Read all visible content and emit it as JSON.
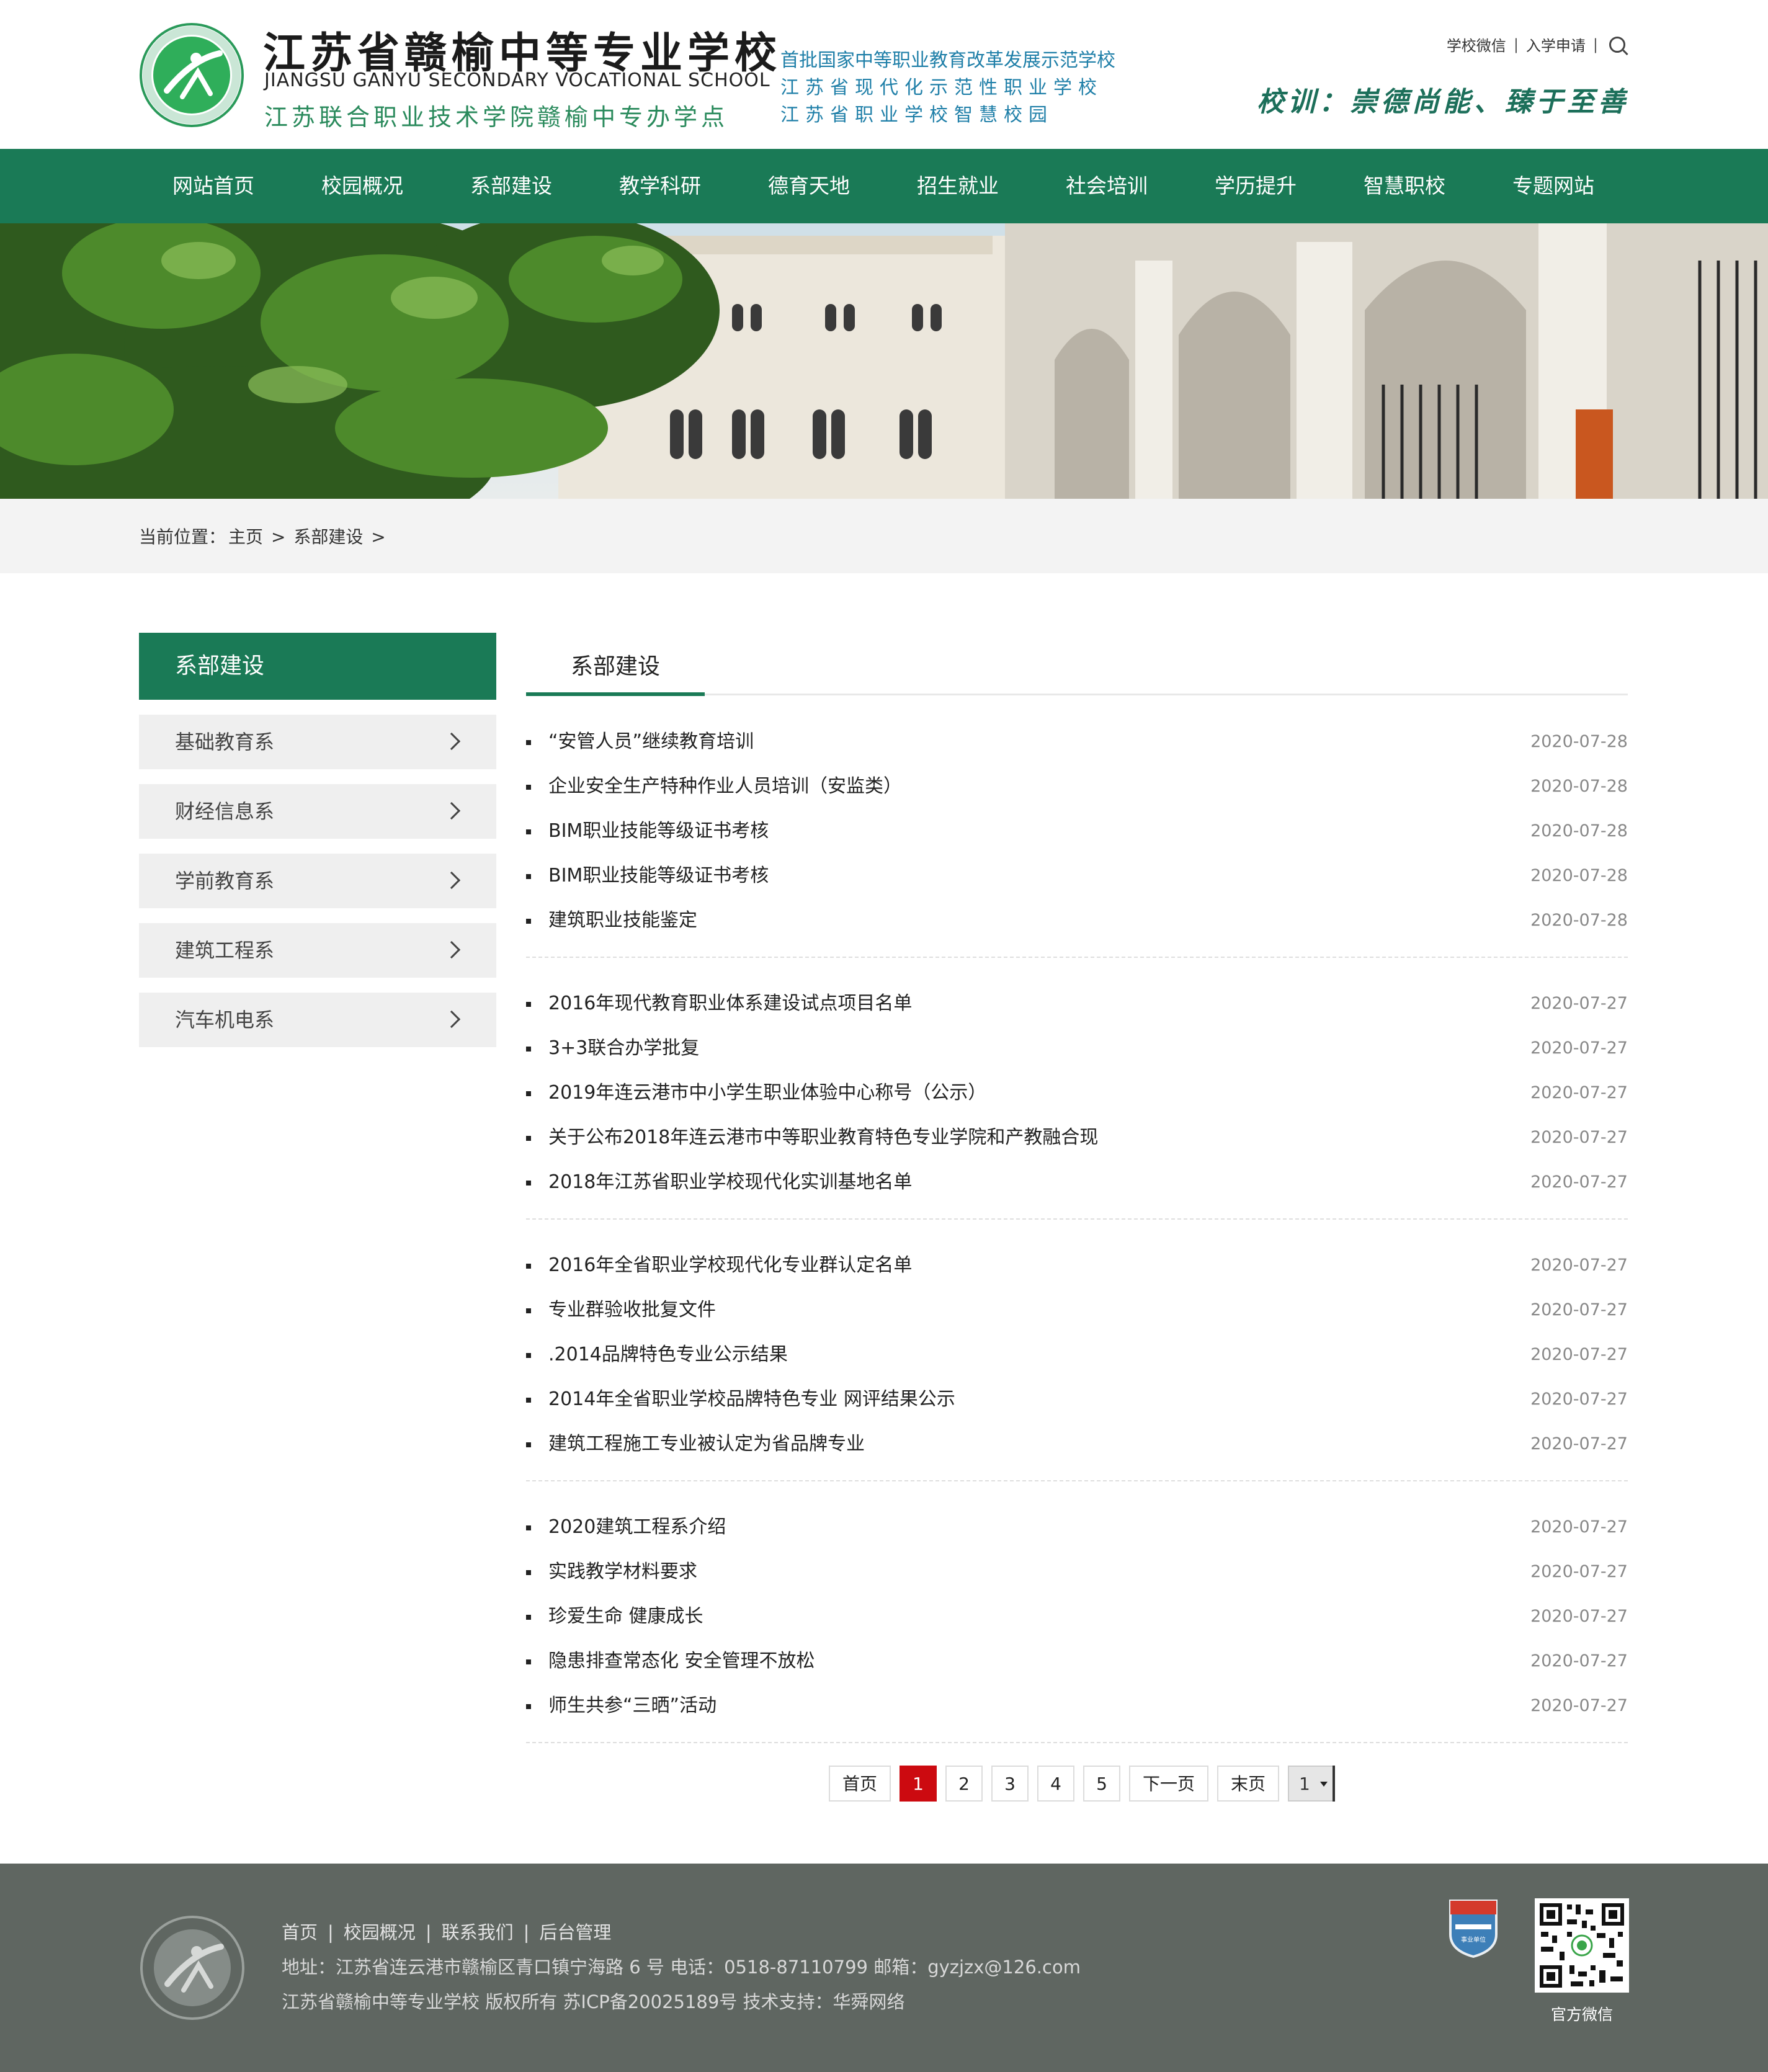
{
  "header": {
    "logo_cn": "江苏省赣榆中等专业学校",
    "logo_en": "JIANGSU GANYU SECONDARY VOCATIONAL SCHOOL",
    "logo_sub": "江苏联合职业技术学院赣榆中专办学点",
    "slogans": [
      "首批国家中等职业教育改革发展示范学校",
      "江苏省现代化示范性职业学校",
      "江苏省职业学校智慧校园"
    ],
    "toplinks": [
      "学校微信",
      "入学申请"
    ],
    "motto": "校训：崇德尚能、臻于至善"
  },
  "nav": [
    "网站首页",
    "校园概况",
    "系部建设",
    "教学科研",
    "德育天地",
    "招生就业",
    "社会培训",
    "学历提升",
    "智慧职校",
    "专题网站"
  ],
  "breadcrumb": {
    "prefix": "当前位置：",
    "home": "主页",
    "sep": ">",
    "current": "系部建设",
    "tail": ">"
  },
  "sidebar": {
    "title": "系部建设",
    "items": [
      "基础教育系",
      "财经信息系",
      "学前教育系",
      "建筑工程系",
      "汽车机电系"
    ]
  },
  "content": {
    "tab": "系部建设",
    "groups": [
      [
        {
          "title": "“安管人员”继续教育培训",
          "date": "2020-07-28"
        },
        {
          "title": "企业安全生产特种作业人员培训（安监类）",
          "date": "2020-07-28"
        },
        {
          "title": "BIM职业技能等级证书考核",
          "date": "2020-07-28"
        },
        {
          "title": "BIM职业技能等级证书考核",
          "date": "2020-07-28"
        },
        {
          "title": "建筑职业技能鉴定",
          "date": "2020-07-28"
        }
      ],
      [
        {
          "title": "2016年现代教育职业体系建设试点项目名单",
          "date": "2020-07-27"
        },
        {
          "title": "3+3联合办学批复",
          "date": "2020-07-27"
        },
        {
          "title": "2019年连云港市中小学生职业体验中心称号（公示）",
          "date": "2020-07-27"
        },
        {
          "title": "关于公布2018年连云港市中等职业教育特色专业学院和产教融合现",
          "date": "2020-07-27"
        },
        {
          "title": "2018年江苏省职业学校现代化实训基地名单",
          "date": "2020-07-27"
        }
      ],
      [
        {
          "title": "2016年全省职业学校现代化专业群认定名单",
          "date": "2020-07-27"
        },
        {
          "title": "专业群验收批复文件",
          "date": "2020-07-27"
        },
        {
          "title": ".2014品牌特色专业公示结果",
          "date": "2020-07-27"
        },
        {
          "title": "2014年全省职业学校品牌特色专业 网评结果公示",
          "date": "2020-07-27"
        },
        {
          "title": "建筑工程施工专业被认定为省品牌专业",
          "date": "2020-07-27"
        }
      ],
      [
        {
          "title": "2020建筑工程系介绍",
          "date": "2020-07-27"
        },
        {
          "title": "实践教学材料要求",
          "date": "2020-07-27"
        },
        {
          "title": "珍爱生命 健康成长",
          "date": "2020-07-27"
        },
        {
          "title": "隐患排查常态化 安全管理不放松",
          "date": "2020-07-27"
        },
        {
          "title": "师生共参“三晒”活动",
          "date": "2020-07-27"
        }
      ]
    ]
  },
  "pager": {
    "first": "首页",
    "pages": [
      "1",
      "2",
      "3",
      "4",
      "5"
    ],
    "current": "1",
    "next": "下一页",
    "last": "末页",
    "select_value": "1"
  },
  "footer": {
    "links": [
      "首页",
      "校园概况",
      "联系我们",
      "后台管理"
    ],
    "address": "地址：江苏省连云港市赣榆区青口镇宁海路 6 号  电话：0518-87110799  邮箱：gyzjzx@126.com",
    "copyright": "江苏省赣榆中等专业学校 版权所有 苏ICP备20025189号 技术支持：华舜网络",
    "badge_text": "事业单位",
    "qr_label": "官方微信"
  },
  "colors": {
    "brand_green": "#1a7a56",
    "active_page": "#cc0a10",
    "footer_bg": "#5f6661"
  }
}
